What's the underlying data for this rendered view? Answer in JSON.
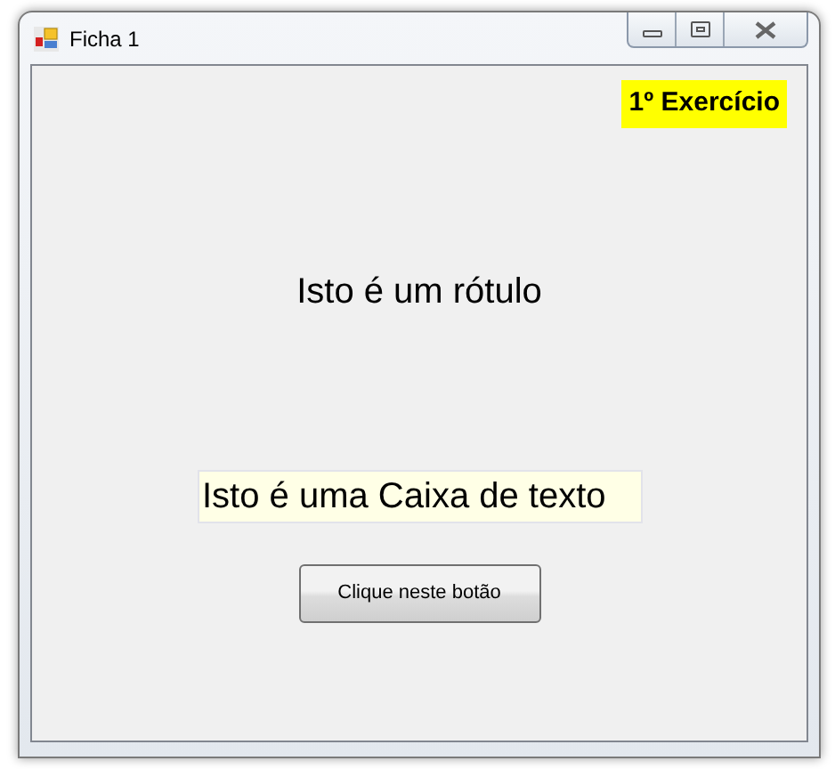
{
  "window": {
    "title": "Ficha 1"
  },
  "badge": "1º Exercício",
  "label": "Isto é um rótulo",
  "textbox": {
    "value": "Isto é uma Caixa de texto"
  },
  "button": "Clique neste botão"
}
